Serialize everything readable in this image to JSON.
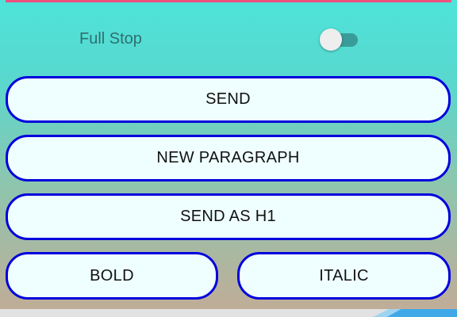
{
  "colors": {
    "accent_bar": "#f0507e",
    "button_border": "#0000dd",
    "button_fill": "#effefe",
    "switch_track": "#3a9c98",
    "label_text": "#2f6f71"
  },
  "settings": {
    "full_stop_label": "Full Stop",
    "full_stop_enabled": false
  },
  "buttons": {
    "send": "SEND",
    "new_paragraph": "NEW PARAGRAPH",
    "send_as_h1": "SEND AS H1",
    "bold": "BOLD",
    "italic": "ITALIC"
  }
}
